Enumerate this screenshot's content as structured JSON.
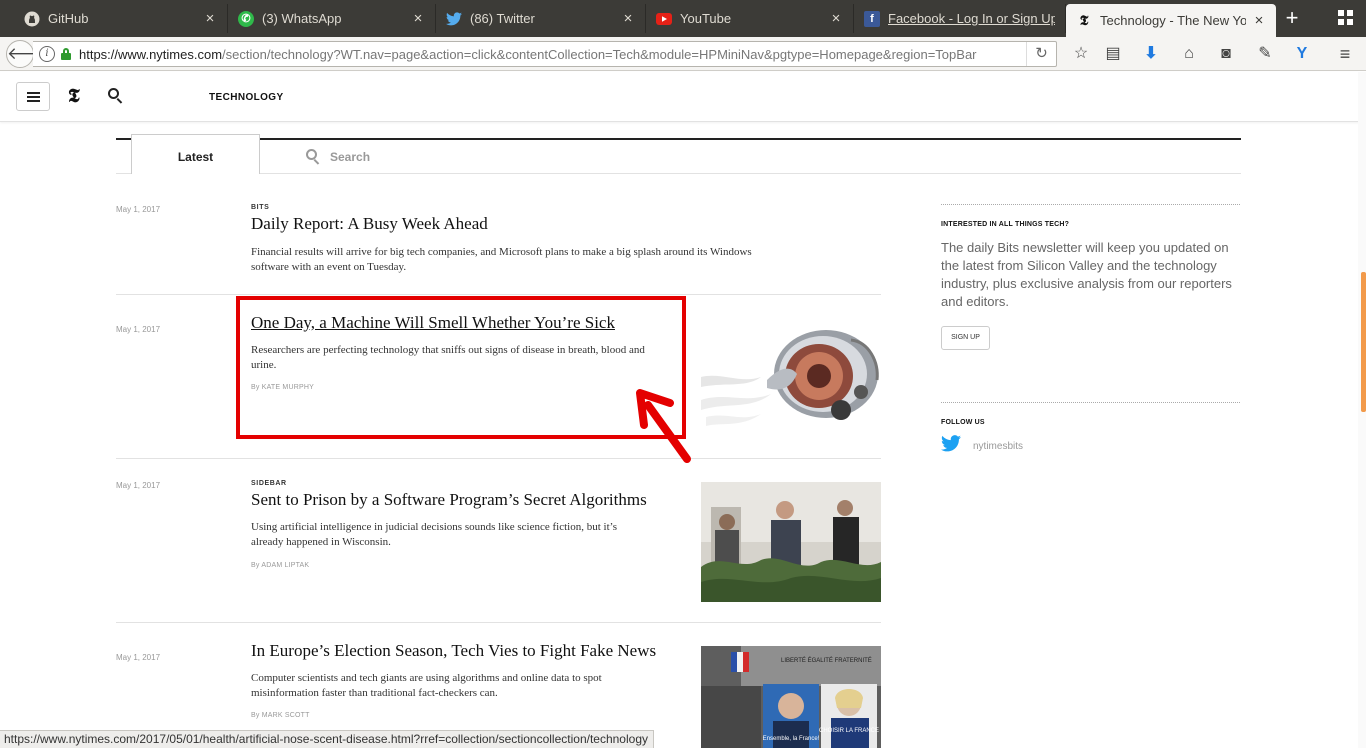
{
  "browser": {
    "tabs": [
      {
        "title": "GitHub",
        "icon": "github-icon"
      },
      {
        "title": "(3) WhatsApp",
        "icon": "whatsapp-icon"
      },
      {
        "title": "(86) Twitter",
        "icon": "twitter-icon"
      },
      {
        "title": "YouTube",
        "icon": "youtube-icon"
      },
      {
        "title": "Facebook - Log In or Sign Up",
        "icon": "facebook-icon"
      },
      {
        "title": "Technology - The New York",
        "icon": "nyt-icon",
        "active": true
      }
    ],
    "url_domain": "https://www.nytimes.com",
    "url_rest": "/section/technology?WT.nav=page&action=click&contentCollection=Tech&module=HPMiniNav&pgtype=Homepage&region=TopBar",
    "status_url": "https://www.nytimes.com/2017/05/01/health/artificial-nose-scent-disease.html?rref=collection/sectioncollection/technology"
  },
  "header": {
    "logo": "𝕿",
    "section": "TECHNOLOGY"
  },
  "tabs": {
    "latest": "Latest",
    "search": "Search"
  },
  "stories": [
    {
      "date": "May 1, 2017",
      "kicker": "BITS",
      "headline": "Daily Report: A Busy Week Ahead",
      "summary": "Financial results will arrive for big tech companies, and Microsoft plans to make a big splash around its Windows software with an event on Tuesday.",
      "byline": ""
    },
    {
      "date": "May 1, 2017",
      "kicker": "",
      "headline": "One Day, a Machine Will Smell Whether You’re Sick",
      "summary": "Researchers are perfecting technology that sniffs out signs of disease in breath, blood and urine.",
      "byline": "By KATE MURPHY"
    },
    {
      "date": "May 1, 2017",
      "kicker": "SIDEBAR",
      "headline": "Sent to Prison by a Software Program’s Secret Algorithms",
      "summary": "Using artificial intelligence in judicial decisions sounds like science fiction, but it’s already happened in Wisconsin.",
      "byline": "By ADAM LIPTAK"
    },
    {
      "date": "May 1, 2017",
      "kicker": "",
      "headline": "In Europe’s Election Season, Tech Vies to Fight Fake News",
      "summary": "Computer scientists and tech giants are using algorithms and online data to spot misinformation faster than traditional fact-checkers can.",
      "byline": "By MARK SCOTT"
    }
  ],
  "sidebar": {
    "newsletter_head": "INTERESTED IN ALL THINGS TECH?",
    "newsletter_text": "The daily Bits newsletter will keep you updated on the latest from Silicon Valley and the technology industry, plus exclusive analysis from our reporters and editors.",
    "signup": "SIGN UP",
    "follow_head": "FOLLOW US",
    "twitter_handle": "nytimesbits"
  },
  "thumb_text": {
    "sign": "LIBERTÉ ÉGALITÉ FRATERNITÉ",
    "poster1": "Ensemble, la France!",
    "poster2": "CHOISIR LA FRANCE"
  },
  "colors": {
    "annotation": "#e40000",
    "twitter": "#1da1f2",
    "tabbar": "#3c3b37"
  }
}
